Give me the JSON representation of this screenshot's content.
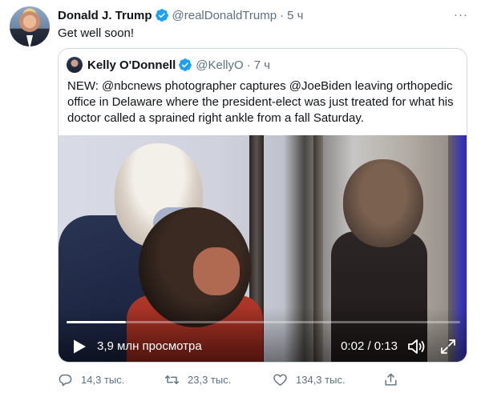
{
  "tweet": {
    "author_name": "Donald J. Trump",
    "author_handle": "@realDonaldTrump",
    "separator": "·",
    "time": "5 ч",
    "more_label": "···",
    "text": "Get well soon!"
  },
  "quoted": {
    "author_name": "Kelly O'Donnell",
    "author_handle": "@KellyO",
    "separator": "·",
    "time": "7 ч",
    "text": "NEW:  @nbcnews photographer captures @JoeBiden leaving orthopedic office in Delaware where the president-elect was just treated for what his doctor called a sprained right ankle from a fall Saturday.",
    "video": {
      "views": "3,9 млн просмотра",
      "timecode": "0:02 / 0:13",
      "progress": 0.15
    }
  },
  "actions": {
    "reply_count": "14,3 тыс.",
    "retweet_count": "23,3 тыс.",
    "like_count": "134,3 тыс."
  },
  "colors": {
    "verified": "#1da1f2",
    "secondary_text": "#5b7083",
    "border": "#cfd9de"
  },
  "icons": [
    "verified-icon",
    "more-icon",
    "play-icon",
    "sound-icon",
    "fullscreen-icon",
    "reply-icon",
    "retweet-icon",
    "like-icon",
    "share-icon"
  ]
}
